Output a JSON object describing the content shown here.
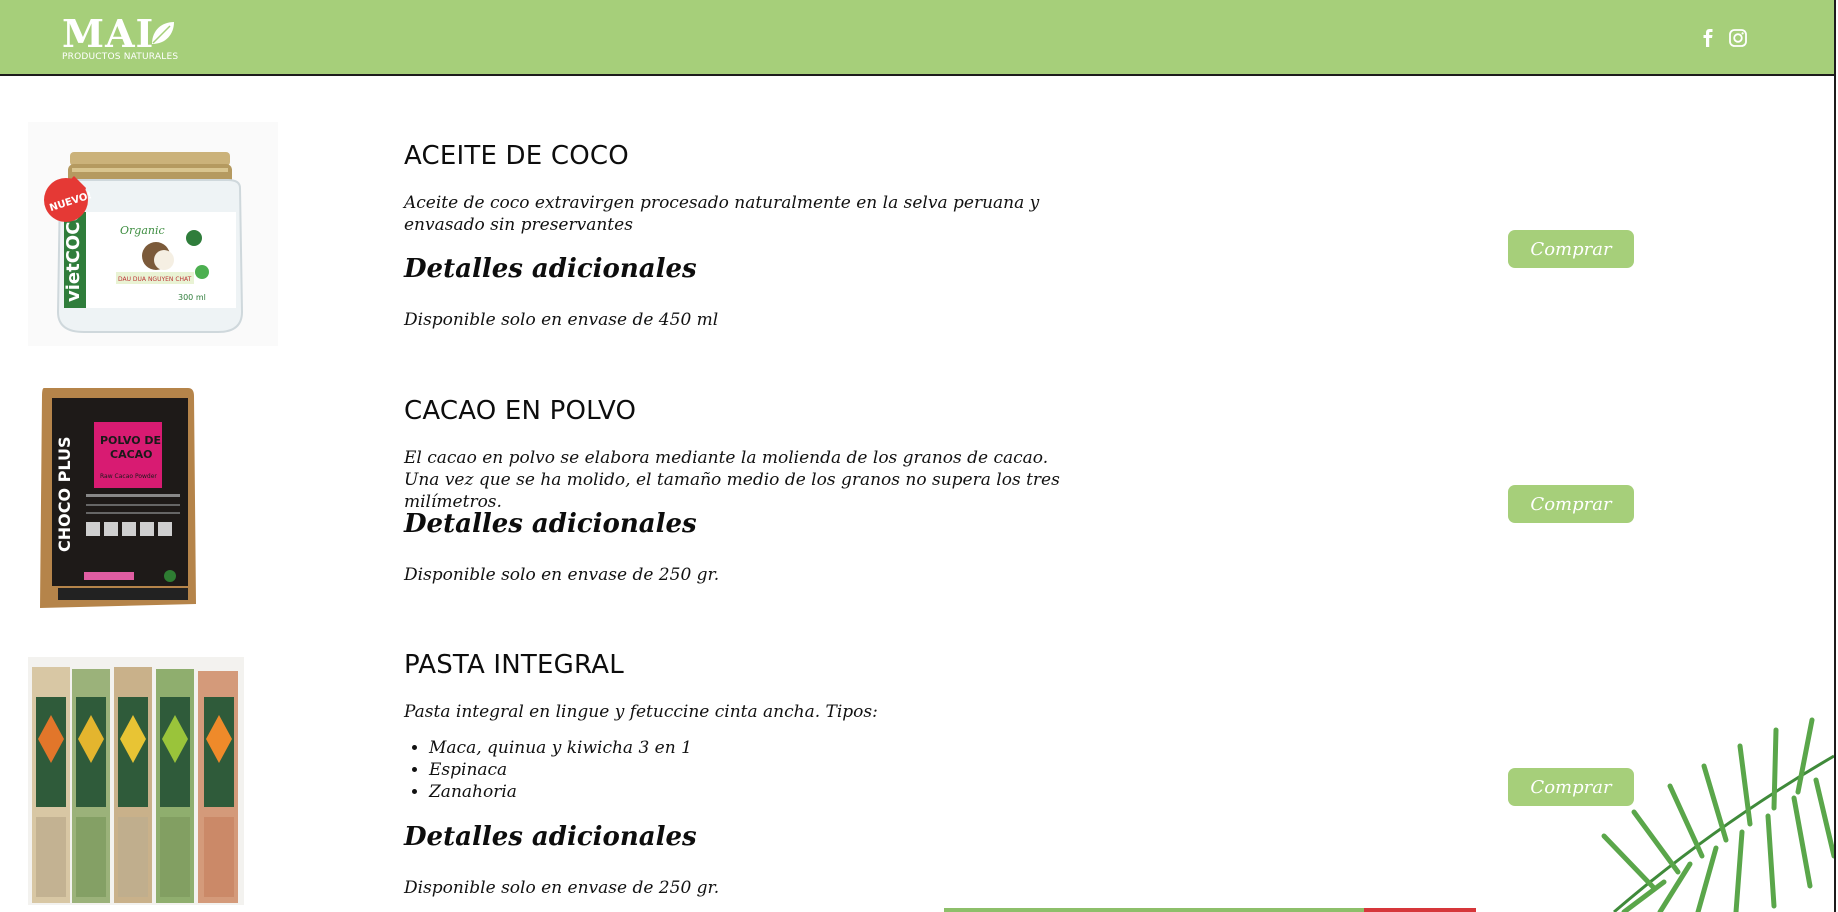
{
  "header": {
    "logo_text": "MAI",
    "logo_subtitle": "PRODUCTOS NATURALES",
    "brand_color": "#a6cf7a",
    "social_icons": [
      "facebook-icon",
      "instagram-icon"
    ]
  },
  "products": [
    {
      "title": "ACEITE DE COCO",
      "description": "Aceite de coco extravirgen procesado naturalmente en la selva peruana y envasado sin preservantes",
      "details_heading": "Detalles adicionales",
      "details": "Disponible solo en envase de 450 ml",
      "button": "Comprar",
      "image": {
        "badge": "NUEVO!",
        "brand": "vietCOCO",
        "tag": "Organic",
        "volume": "300 ml"
      }
    },
    {
      "title": "CACAO EN POLVO",
      "description": "El cacao en polvo se elabora mediante la molienda de los granos de cacao. Una vez que se ha molido, el tamaño medio de los granos no supera los tres milímetros.",
      "details_heading": "Detalles adicionales",
      "details": "Disponible solo en envase de 250 gr.",
      "button": "Comprar",
      "image": {
        "brand": "CHOCO PLUS",
        "label": "POLVO DE CACAO"
      }
    },
    {
      "title": "PASTA INTEGRAL",
      "description": "Pasta integral en lingue y fetuccine cinta ancha. Tipos:",
      "types": [
        "Maca, quinua y kiwicha 3 en 1",
        "Espinaca",
        "Zanahoria"
      ],
      "details_heading": "Detalles adicionales",
      "details": "Disponible solo en envase de 250 gr.",
      "button": "Comprar"
    }
  ]
}
